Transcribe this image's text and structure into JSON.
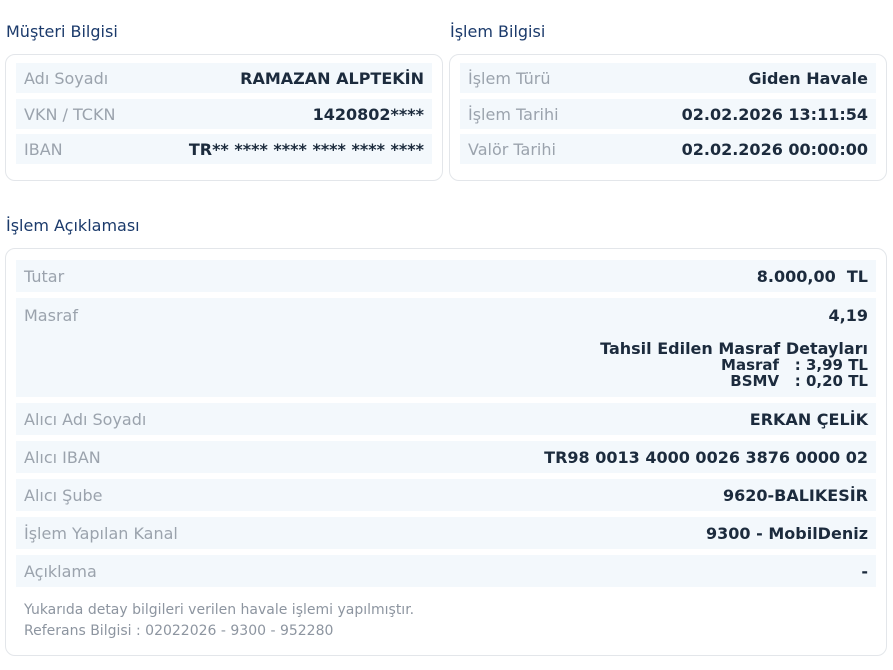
{
  "customer": {
    "title": "Müşteri Bilgisi",
    "rows": [
      {
        "label": "Adı Soyadı",
        "value": "RAMAZAN ALPTEKİN"
      },
      {
        "label": "VKN / TCKN",
        "value": "1420802****"
      },
      {
        "label": "IBAN",
        "value": "TR** **** **** **** **** ****"
      }
    ]
  },
  "transaction": {
    "title": "İşlem Bilgisi",
    "rows": [
      {
        "label": "İşlem Türü",
        "value": "Giden Havale"
      },
      {
        "label": "İşlem Tarihi",
        "value": "02.02.2026 13:11:54"
      },
      {
        "label": "Valör Tarihi",
        "value": "02.02.2026 00:00:00"
      }
    ]
  },
  "details": {
    "title": "İşlem Açıklaması",
    "amount": {
      "label": "Tutar",
      "value": "8.000,00  TL"
    },
    "fee": {
      "label": "Masraf",
      "value": "4,19",
      "detail_title": "Tahsil Edilen Masraf Detayları",
      "lines": [
        {
          "key": "Masraf",
          "value": ": 3,99 TL"
        },
        {
          "key": "BSMV",
          "value": ": 0,20 TL"
        }
      ]
    },
    "rows": [
      {
        "label": "Alıcı Adı Soyadı",
        "value": "ERKAN ÇELİK"
      },
      {
        "label": "Alıcı IBAN",
        "value": "TR98 0013 4000 0026 3876 0000 02"
      },
      {
        "label": "Alıcı Şube",
        "value": "9620-BALIKESİR"
      },
      {
        "label": "İşlem Yapılan Kanal",
        "value": "9300 - MobilDeniz"
      },
      {
        "label": "Açıklama",
        "value": "-"
      }
    ],
    "note_line1": "Yukarıda detay bilgileri verilen havale işlemi yapılmıştır.",
    "note_line2": "Referans Bilgisi : 02022026 - 9300 - 952280"
  }
}
